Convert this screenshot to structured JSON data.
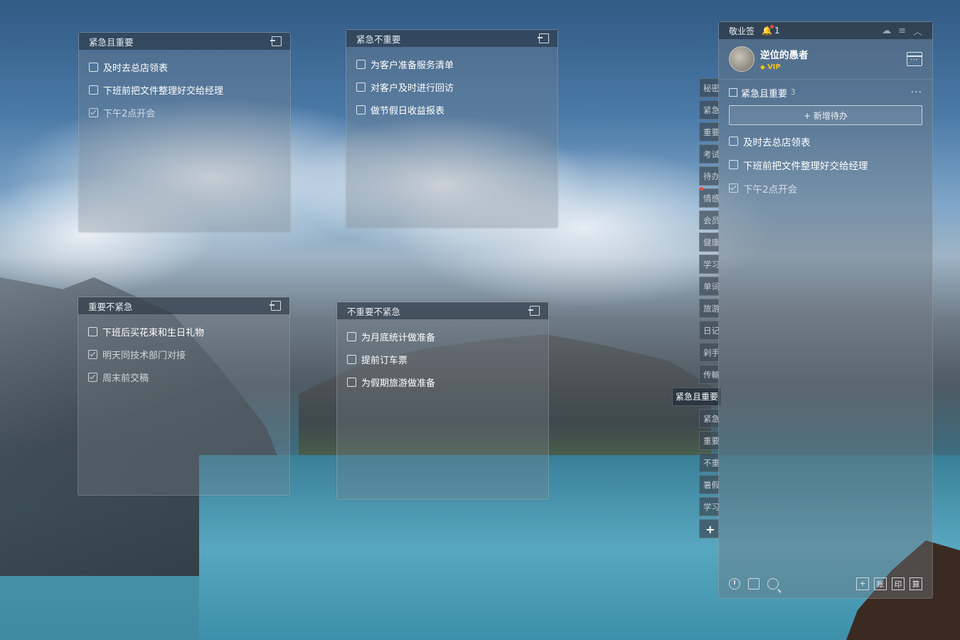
{
  "notes": [
    {
      "title": "紧急且重要",
      "tasks": [
        {
          "text": "及时去总店领表",
          "done": false
        },
        {
          "text": "下班前把文件整理好交给经理",
          "done": false
        },
        {
          "text": "下午2点开会",
          "done": true
        }
      ]
    },
    {
      "title": "紧急不重要",
      "tasks": [
        {
          "text": "为客户准备服务清单",
          "done": false
        },
        {
          "text": "对客户及时进行回访",
          "done": false
        },
        {
          "text": "做节假日收益报表",
          "done": false
        }
      ]
    },
    {
      "title": "重要不紧急",
      "tasks": [
        {
          "text": "下班后买花束和生日礼物",
          "done": false
        },
        {
          "text": "明天同技术部门对接",
          "done": true
        },
        {
          "text": "周末前交稿",
          "done": true
        }
      ]
    },
    {
      "title": "不重要不紧急",
      "tasks": [
        {
          "text": "为月底统计做准备",
          "done": false
        },
        {
          "text": "提前订车票",
          "done": false
        },
        {
          "text": "为假期旅游做准备",
          "done": false
        }
      ]
    }
  ],
  "panel": {
    "app_name": "敬业签",
    "notification_count": "1",
    "username": "逆位的愚者",
    "vip_label": "VIP",
    "list_title": "紧急且重要",
    "list_count": "3",
    "more_label": "···",
    "add_todo_label": "+ 新增待办",
    "tasks": [
      {
        "text": "及时去总店领表",
        "done": false
      },
      {
        "text": "下班前把文件整理好交给经理",
        "done": false
      },
      {
        "text": "下午2点开会",
        "done": true
      }
    ],
    "footer_buttons": [
      "+",
      "账",
      "印",
      "算"
    ]
  },
  "tabs": [
    "秘密",
    "紧急",
    "重要",
    "考试",
    "待办",
    "情感",
    "会员",
    "健康",
    "学习",
    "单词",
    "旅游",
    "日记",
    "剁手",
    "传輸"
  ],
  "tabs_after": [
    "紧急",
    "重要",
    "不重",
    "暑假",
    "学习"
  ],
  "tab_popup": "紧急且重要",
  "add_tab_label": "+"
}
